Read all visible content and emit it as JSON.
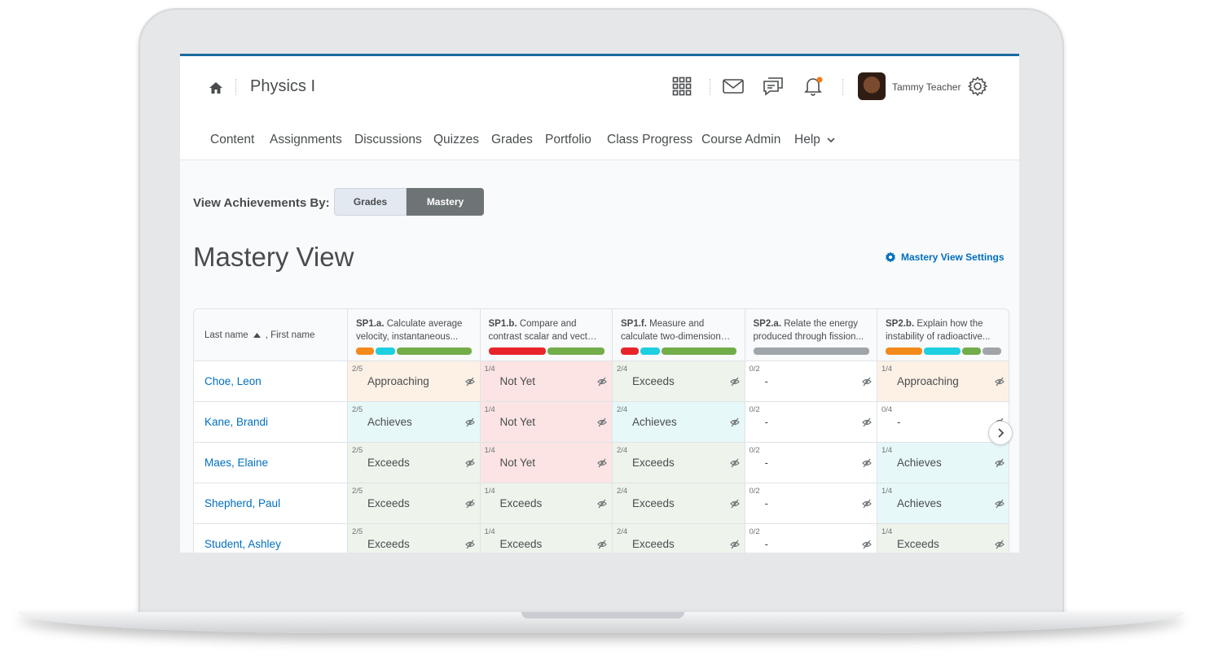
{
  "header": {
    "course_title": "Physics I",
    "user_name": "Tammy Teacher",
    "icons": [
      "home-icon",
      "apps-grid-icon",
      "mail-icon",
      "chat-icon",
      "bell-icon",
      "gear-icon"
    ],
    "notification_dot_color": "#f17a1c"
  },
  "nav": {
    "items": [
      "Content",
      "Assignments",
      "Discussions",
      "Quizzes",
      "Grades",
      "Portfolio",
      "Class Progress",
      "Course Admin",
      "Help"
    ]
  },
  "view_toggle": {
    "label": "View Achievements By:",
    "options": [
      "Grades",
      "Mastery"
    ],
    "selected": "Mastery"
  },
  "page": {
    "title": "Mastery View",
    "settings_link": "Mastery View Settings"
  },
  "table": {
    "name_header": {
      "last": "Last name",
      "first": ", First name"
    },
    "columns": [
      {
        "code": "SP1.a.",
        "line1": "Calculate average",
        "line2": "velocity, instantaneous...",
        "bar": [
          [
            "#f38a1c",
            0.16
          ],
          [
            "#1ecfe0",
            0.17
          ],
          [
            "#72ad4a",
            0.67
          ]
        ]
      },
      {
        "code": "SP1.b.",
        "line1": "Compare and",
        "line2": "contrast scalar and vector...",
        "bar": [
          [
            "#e8242a",
            0.5
          ],
          [
            "#72ad4a",
            0.5
          ]
        ]
      },
      {
        "code": "SP1.f.",
        "line1": "Measure and",
        "line2": "calculate two-dimensional...",
        "bar": [
          [
            "#e8242a",
            0.16
          ],
          [
            "#1ecfe0",
            0.17
          ],
          [
            "#72ad4a",
            0.67
          ]
        ]
      },
      {
        "code": "SP2.a.",
        "line1": "Relate the energy",
        "line2": "produced through fission...",
        "bar": [
          [
            "#a0a5a9",
            1.0
          ]
        ]
      },
      {
        "code": "SP2.b.",
        "line1": "Explain how the",
        "line2": "instability of radioactive...",
        "bar": [
          [
            "#f38a1c",
            0.33
          ],
          [
            "#1ecfe0",
            0.33
          ],
          [
            "#72ad4a",
            0.17
          ],
          [
            "#a0a5a9",
            0.17
          ]
        ]
      }
    ],
    "level_colors": {
      "Approaching": "#fdf1e6",
      "Not Yet": "#fce4e4",
      "Achieves": "#e7f8f9",
      "Exceeds": "#eef4eb",
      "-": "#ffffff"
    },
    "rows": [
      {
        "name": "Choe, Leon",
        "cells": [
          [
            "2/5",
            "Approaching"
          ],
          [
            "1/4",
            "Not Yet"
          ],
          [
            "2/4",
            "Exceeds"
          ],
          [
            "0/2",
            "-"
          ],
          [
            "1/4",
            "Approaching"
          ]
        ]
      },
      {
        "name": "Kane, Brandi",
        "cells": [
          [
            "2/5",
            "Achieves"
          ],
          [
            "1/4",
            "Not Yet"
          ],
          [
            "2/4",
            "Achieves"
          ],
          [
            "0/2",
            "-"
          ],
          [
            "0/4",
            "-"
          ]
        ]
      },
      {
        "name": "Maes, Elaine",
        "cells": [
          [
            "2/5",
            "Exceeds"
          ],
          [
            "1/4",
            "Not Yet"
          ],
          [
            "2/4",
            "Exceeds"
          ],
          [
            "0/2",
            "-"
          ],
          [
            "1/4",
            "Achieves"
          ]
        ]
      },
      {
        "name": "Shepherd, Paul",
        "cells": [
          [
            "2/5",
            "Exceeds"
          ],
          [
            "1/4",
            "Exceeds"
          ],
          [
            "2/4",
            "Exceeds"
          ],
          [
            "0/2",
            "-"
          ],
          [
            "1/4",
            "Achieves"
          ]
        ]
      },
      {
        "name": "Student, Ashley",
        "cells": [
          [
            "2/5",
            "Exceeds"
          ],
          [
            "1/4",
            "Exceeds"
          ],
          [
            "2/4",
            "Exceeds"
          ],
          [
            "0/2",
            "-"
          ],
          [
            "1/4",
            "Exceeds"
          ]
        ]
      }
    ]
  }
}
